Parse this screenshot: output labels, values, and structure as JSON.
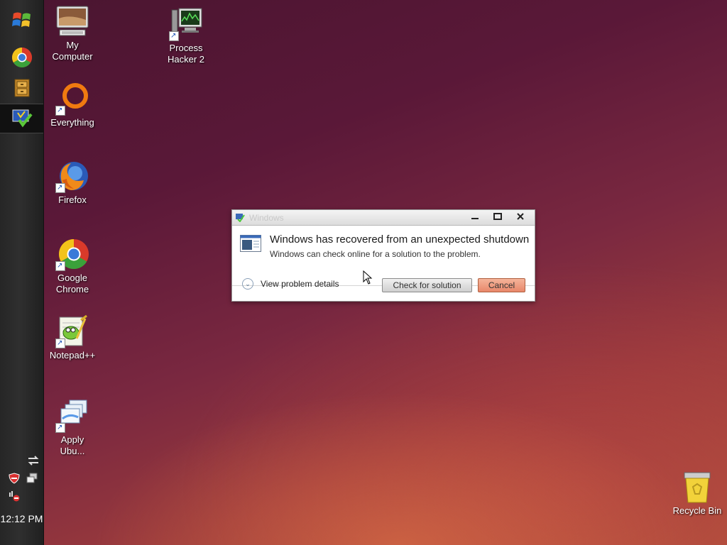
{
  "taskbar": {
    "clock": "12:12 PM",
    "buttons": [
      {
        "name": "start-button",
        "icon": "windows-logo-icon"
      },
      {
        "name": "chrome-taskbar-button",
        "icon": "chrome-icon"
      },
      {
        "name": "file-cabinet-taskbar-button",
        "icon": "cabinet-icon"
      },
      {
        "name": "windows-task-taskbar-button",
        "icon": "monitor-check-icon",
        "active": true
      }
    ]
  },
  "desktop": {
    "icons": [
      {
        "name": "my-computer",
        "label_1": "My",
        "label_2": "Computer"
      },
      {
        "name": "process-hacker",
        "label_1": "Process",
        "label_2": "Hacker 2"
      },
      {
        "name": "everything",
        "label_1": "Everything",
        "label_2": ""
      },
      {
        "name": "firefox",
        "label_1": "Firefox",
        "label_2": ""
      },
      {
        "name": "google-chrome",
        "label_1": "Google",
        "label_2": "Chrome"
      },
      {
        "name": "notepad-plus-plus",
        "label_1": "Notepad++",
        "label_2": ""
      },
      {
        "name": "apply-ubuntu",
        "label_1": "Apply",
        "label_2": "Ubu..."
      },
      {
        "name": "recycle-bin",
        "label_1": "Recycle Bin",
        "label_2": ""
      }
    ]
  },
  "dialog": {
    "title": "Windows",
    "main_text": "Windows has recovered from an unexpected shutdown",
    "sub_text": "Windows can check online for a solution to the problem.",
    "details_label": "View problem details",
    "check_label": "Check for solution",
    "cancel_label": "Cancel"
  },
  "colors": {
    "cancel_button": "#e8876a",
    "taskbar": "#2a2a2a"
  }
}
